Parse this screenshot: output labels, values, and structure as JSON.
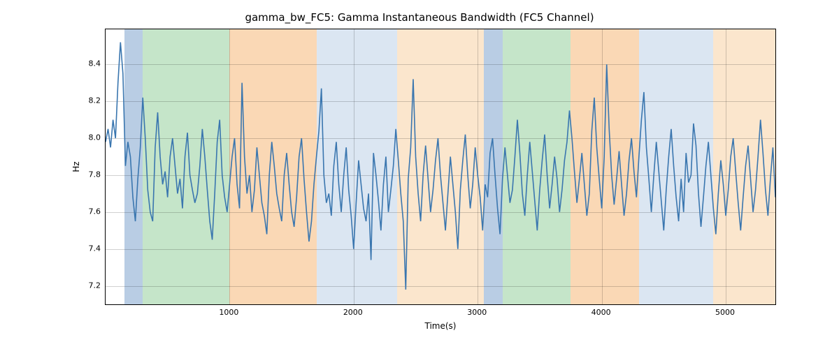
{
  "chart_data": {
    "type": "line",
    "title": "gamma_bw_FC5: Gamma Instantaneous Bandwidth (FC5 Channel)",
    "xlabel": "Time(s)",
    "ylabel": "Hz",
    "xlim": [
      0,
      5400
    ],
    "ylim": [
      7.1,
      8.59
    ],
    "xticks": [
      1000,
      2000,
      3000,
      4000,
      5000
    ],
    "yticks": [
      7.2,
      7.4,
      7.6,
      7.8,
      8.0,
      8.2,
      8.4
    ],
    "grid": true,
    "bands": [
      {
        "start": 150,
        "end": 300,
        "color": "#b9cde4"
      },
      {
        "start": 300,
        "end": 1000,
        "color": "#c5e5c9"
      },
      {
        "start": 1000,
        "end": 1700,
        "color": "#fad8b5"
      },
      {
        "start": 1700,
        "end": 2350,
        "color": "#dbe6f2"
      },
      {
        "start": 2350,
        "end": 3050,
        "color": "#fbe6cd"
      },
      {
        "start": 3050,
        "end": 3200,
        "color": "#b9cde4"
      },
      {
        "start": 3200,
        "end": 3750,
        "color": "#c5e5c9"
      },
      {
        "start": 3750,
        "end": 4300,
        "color": "#fad8b5"
      },
      {
        "start": 4300,
        "end": 4900,
        "color": "#dbe6f2"
      },
      {
        "start": 4900,
        "end": 5400,
        "color": "#fbe6cd"
      }
    ],
    "series": [
      {
        "name": "gamma_bw_FC5",
        "color": "#3a76af",
        "x_step": 20,
        "values": [
          7.98,
          8.05,
          7.95,
          8.1,
          8.0,
          8.3,
          8.52,
          8.35,
          7.85,
          7.98,
          7.9,
          7.68,
          7.55,
          7.78,
          7.95,
          8.22,
          8.0,
          7.72,
          7.6,
          7.55,
          7.95,
          8.14,
          7.9,
          7.75,
          7.82,
          7.68,
          7.9,
          8.0,
          7.85,
          7.7,
          7.78,
          7.62,
          7.9,
          8.03,
          7.8,
          7.72,
          7.65,
          7.7,
          7.85,
          8.05,
          7.9,
          7.72,
          7.55,
          7.45,
          7.7,
          7.98,
          8.1,
          7.8,
          7.68,
          7.6,
          7.75,
          7.9,
          8.0,
          7.75,
          7.62,
          8.3,
          7.9,
          7.7,
          7.8,
          7.6,
          7.72,
          7.95,
          7.8,
          7.65,
          7.58,
          7.48,
          7.8,
          7.98,
          7.85,
          7.7,
          7.62,
          7.55,
          7.8,
          7.92,
          7.75,
          7.6,
          7.52,
          7.68,
          7.9,
          8.0,
          7.78,
          7.6,
          7.44,
          7.55,
          7.75,
          7.9,
          8.04,
          8.27,
          7.8,
          7.65,
          7.7,
          7.58,
          7.85,
          7.98,
          7.75,
          7.6,
          7.8,
          7.95,
          7.72,
          7.58,
          7.4,
          7.65,
          7.88,
          7.75,
          7.62,
          7.55,
          7.7,
          7.34,
          7.92,
          7.8,
          7.66,
          7.5,
          7.75,
          7.9,
          7.6,
          7.72,
          7.85,
          8.05,
          7.88,
          7.7,
          7.55,
          7.18,
          7.78,
          7.95,
          8.32,
          7.9,
          7.7,
          7.55,
          7.8,
          7.96,
          7.78,
          7.6,
          7.72,
          7.88,
          8.0,
          7.8,
          7.65,
          7.5,
          7.7,
          7.9,
          7.75,
          7.6,
          7.4,
          7.72,
          7.88,
          8.02,
          7.8,
          7.62,
          7.75,
          7.95,
          7.8,
          7.68,
          7.5,
          7.75,
          7.68,
          7.92,
          8.0,
          7.8,
          7.62,
          7.48,
          7.78,
          7.95,
          7.8,
          7.65,
          7.72,
          7.9,
          8.1,
          7.92,
          7.7,
          7.58,
          7.8,
          7.98,
          7.82,
          7.66,
          7.5,
          7.72,
          7.88,
          8.02,
          7.8,
          7.62,
          7.75,
          7.9,
          7.78,
          7.6,
          7.72,
          7.88,
          7.98,
          8.15,
          8.0,
          7.82,
          7.65,
          7.78,
          7.92,
          7.75,
          7.58,
          7.7,
          8.04,
          8.22,
          7.95,
          7.78,
          7.62,
          7.9,
          8.4,
          8.05,
          7.8,
          7.64,
          7.78,
          7.93,
          7.75,
          7.58,
          7.7,
          7.88,
          8.0,
          7.82,
          7.68,
          7.9,
          8.1,
          8.25,
          7.95,
          7.78,
          7.6,
          7.8,
          7.98,
          7.82,
          7.66,
          7.5,
          7.72,
          7.9,
          8.05,
          7.85,
          7.68,
          7.55,
          7.78,
          7.6,
          7.92,
          7.76,
          7.8,
          8.08,
          7.96,
          7.7,
          7.52,
          7.68,
          7.85,
          7.98,
          7.8,
          7.62,
          7.48,
          7.7,
          7.88,
          7.75,
          7.58,
          7.72,
          7.9,
          8.0,
          7.82,
          7.65,
          7.5,
          7.68,
          7.85,
          7.96,
          7.78,
          7.6,
          7.72,
          7.9,
          8.1,
          7.92,
          7.72,
          7.58,
          7.78,
          7.95,
          7.68,
          7.85
        ]
      }
    ]
  }
}
